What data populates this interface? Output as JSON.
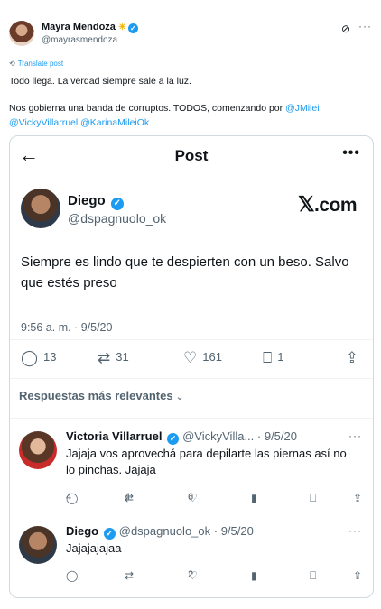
{
  "outer": {
    "author_name": "Mayra Mendoza",
    "author_handle": "@mayrasmendoza",
    "translate_label": "Translate post",
    "text_line1": "Todo llega. La verdad siempre sale a la luz.",
    "text_line2_prefix": "Nos gobierna una banda de corruptos. TODOS, comenzando por ",
    "mentions": [
      "@JMilei",
      "@VickyVillarruel",
      "@KarinaMileiOk"
    ]
  },
  "card": {
    "title": "Post",
    "author_name": "Diego",
    "author_handle": "@dspagnuolo_ok",
    "xcom_label": "com",
    "text": "Siempre es lindo que te despierten con un beso. Salvo que estés preso",
    "timestamp": "9:56 a. m. · 9/5/20",
    "counts": {
      "replies": "13",
      "reposts": "31",
      "likes": "161",
      "bookmarks": "1"
    },
    "replies_header": "Respuestas más relevantes"
  },
  "replies": [
    {
      "name": "Victoria Villarruel",
      "handle": "@VickyVilla... · 9/5/20",
      "text": "Jajaja vos aprovechá para depilarte las piernas así no lo pinchas. Jajaja",
      "counts": {
        "replies": "4",
        "reposts": "4",
        "likes": "6"
      }
    },
    {
      "name": "Diego",
      "handle": "@dspagnuolo_ok · 9/5/20",
      "text": "Jajajajajaa",
      "counts": {
        "replies": "",
        "reposts": "",
        "likes": "2"
      }
    }
  ],
  "colors": {
    "accent": "#1d9bf0",
    "muted": "#536471",
    "border": "#cfd9de"
  },
  "icons": [
    "grok-icon",
    "more-icon",
    "back-arrow-icon",
    "verified-icon",
    "reply-icon",
    "repost-icon",
    "like-icon",
    "bookmark-icon",
    "share-icon",
    "views-icon",
    "chevron-down-icon"
  ]
}
